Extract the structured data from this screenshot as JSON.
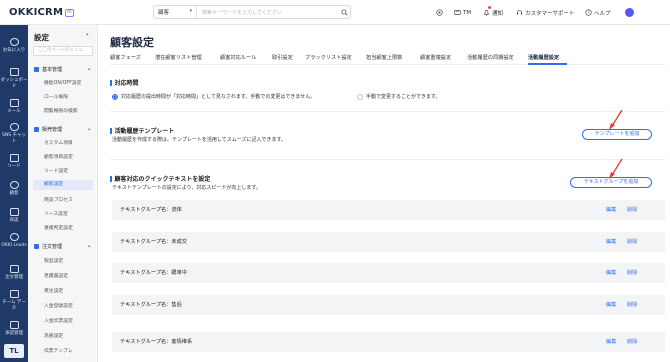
{
  "topbar": {
    "logo_text": "OKKICRM",
    "logo_badge": "AI",
    "search_scope": "顧客",
    "search_placeholder": "検索キーワードを入力してください",
    "user_initials": "TM",
    "notifications": "通知",
    "support": "カスタマーサポート",
    "help": "ヘルプ"
  },
  "rail": {
    "items": [
      {
        "label": "お気に入り"
      },
      {
        "label": "ダッシュボード"
      },
      {
        "label": "メール"
      },
      {
        "label": "SNS チャット"
      },
      {
        "label": "リード"
      },
      {
        "label": "顧客"
      },
      {
        "label": "商談"
      },
      {
        "label": "OKKI Leads"
      },
      {
        "label": "注文管理"
      },
      {
        "label": "チーム データ"
      },
      {
        "label": "承認管理"
      }
    ],
    "bottom_label": "TL"
  },
  "settings": {
    "title": "設定",
    "search_placeholder": "ここのページのメニュ",
    "groups": [
      {
        "label": "基本管理",
        "items": [
          "機能ON/OFF設定",
          "ロール権限",
          "閲覧権限の検索"
        ]
      },
      {
        "label": "販売管理",
        "items": [
          "カスタム項目",
          "顧客項目設定",
          "リード設定",
          "顧客設定",
          "商談プロセス",
          "ソース設定",
          "重複判定設定"
        ]
      },
      {
        "label": "注文管理",
        "items": [
          "製品設定",
          "見積書設定",
          "受注設定",
          "入金登録設定",
          "入金伝票設定",
          "為替設定",
          "伝票テンプレ"
        ]
      }
    ],
    "active_item": "顧客設定"
  },
  "main": {
    "title": "顧客設定",
    "tabs": [
      "顧客フェーズ",
      "潜在顧客リスト管理",
      "顧客対応ルール",
      "取引設定",
      "ブラックリスト設定",
      "担当顧客上限数",
      "顧客重複設定",
      "活動履歴の同期設定",
      "活動履歴設定"
    ],
    "active_tab": "活動履歴設定",
    "section1": {
      "title": "対応時間",
      "option_on": "対応履歴の提出時間が「対応時間」として見なされます。手動での変更はできません。",
      "option_off": "手動で変更することができます。"
    },
    "section2": {
      "title": "活動履歴テンプレート",
      "desc": "活動履歴を作成する際は、テンプレートを活用してスムーズに記入できます。",
      "button": "テンプレートを追加"
    },
    "section3": {
      "title": "顧客対応のクイックテキストを設定",
      "desc": "テキストテンプレートの設定により、対応スピードが向上します。",
      "button": "テキストグループを追加",
      "groups": [
        {
          "label": "テキストグループ名：流体",
          "edit": "編集",
          "delete": "削除"
        },
        {
          "label": "テキストグループ名：未成交",
          "edit": "編集",
          "delete": "削除"
        },
        {
          "label": "テキストグループ名：跟单中",
          "edit": "編集",
          "delete": "削除"
        },
        {
          "label": "テキストグループ名：售后",
          "edit": "編集",
          "delete": "削除"
        },
        {
          "label": "テキストグループ名：客情维系",
          "edit": "編集",
          "delete": "削除"
        }
      ]
    }
  },
  "colors": {
    "accent": "#2f6fed",
    "rail": "#1f3a68",
    "annotation_arrow": "#e53935"
  }
}
